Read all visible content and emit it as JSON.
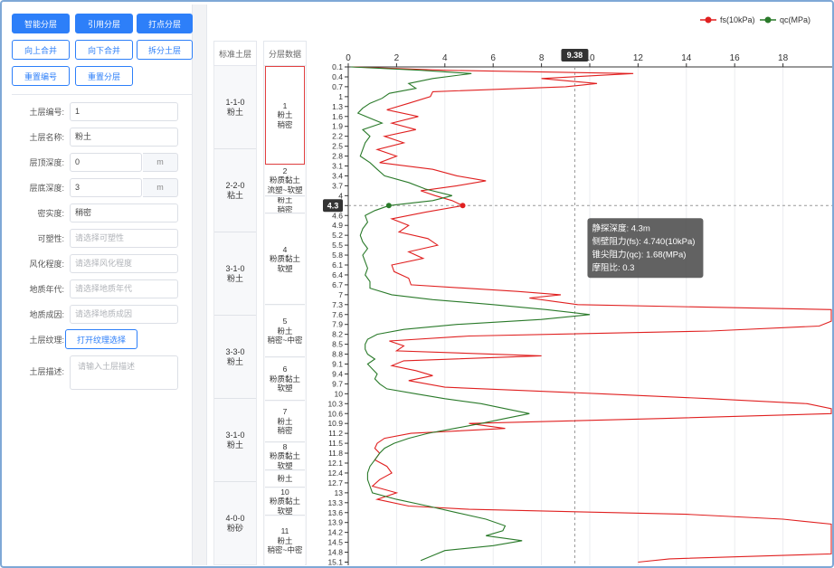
{
  "toolbar": {
    "row1": [
      "智能分层",
      "引用分层",
      "打点分层"
    ],
    "row2": [
      "向上合并",
      "向下合并",
      "拆分土层"
    ],
    "row3": [
      "重置编号",
      "重置分层"
    ]
  },
  "form": {
    "soil_no": {
      "label": "土层编号:",
      "value": "1"
    },
    "soil_name": {
      "label": "土层名称:",
      "value": "粉土"
    },
    "top_depth": {
      "label": "层顶深度:",
      "value": "0",
      "unit": "m"
    },
    "bottom_depth": {
      "label": "层底深度:",
      "value": "3",
      "unit": "m"
    },
    "density": {
      "label": "密实度:",
      "value": "稍密"
    },
    "plasticity": {
      "label": "可塑性:",
      "placeholder": "请选择可塑性"
    },
    "weathering": {
      "label": "风化程度:",
      "placeholder": "请选择风化程度"
    },
    "geo_age": {
      "label": "地质年代:",
      "placeholder": "请选择地质年代"
    },
    "geo_origin": {
      "label": "地质成因:",
      "placeholder": "请选择地质成因"
    },
    "texture": {
      "label": "土层纹理:",
      "button": "打开纹理选择"
    },
    "desc": {
      "label": "土层描述:",
      "placeholder": "请输入土层描述"
    }
  },
  "columns": {
    "std_header": "标准土层",
    "layer_header": "分层数据",
    "std_layers": [
      {
        "code": "1-1-0",
        "name": "粉土"
      },
      {
        "code": "2-2-0",
        "name": "粘土"
      },
      {
        "code": "3-1-0",
        "name": "粉土"
      },
      {
        "code": "3-3-0",
        "name": "粉土"
      },
      {
        "code": "3-1-0",
        "name": "粉土"
      },
      {
        "code": "4-0-0",
        "name": "粉砂"
      }
    ],
    "layers": [
      {
        "no": "1",
        "name": "粉土",
        "state": "稍密"
      },
      {
        "no": "2",
        "name": "粉质黏土",
        "state": "流塑~软塑"
      },
      {
        "no": "",
        "name": "粉土",
        "state": "稍密"
      },
      {
        "no": "4",
        "name": "粉质黏土",
        "state": "软塑"
      },
      {
        "no": "5",
        "name": "粉土",
        "state": "稍密~中密"
      },
      {
        "no": "6",
        "name": "粉质黏土",
        "state": "软塑"
      },
      {
        "no": "7",
        "name": "粉土",
        "state": "稍密"
      },
      {
        "no": "8",
        "name": "粉质黏土",
        "state": "软塑"
      },
      {
        "no": "",
        "name": "粉土",
        "state": ""
      },
      {
        "no": "10",
        "name": "粉质黏土",
        "state": "软塑"
      },
      {
        "no": "11",
        "name": "粉土",
        "state": "稍密~中密"
      }
    ]
  },
  "chart_data": {
    "type": "line",
    "legend": [
      "fs(10kPa)",
      "qc(MPa)"
    ],
    "legend_position": "top-right",
    "x_ticks": [
      "0",
      "2",
      "4",
      "6",
      "8",
      "10",
      "12",
      "14",
      "16",
      "18"
    ],
    "xlim": [
      0,
      20
    ],
    "y_ticks": [
      "0.1",
      "0.4",
      "0.7",
      "1",
      "1.3",
      "1.6",
      "1.9",
      "2.2",
      "2.5",
      "2.8",
      "3.1",
      "3.4",
      "3.7",
      "4",
      "4.3",
      "4.6",
      "4.9",
      "5.2",
      "5.5",
      "5.8",
      "6.1",
      "6.4",
      "6.7",
      "7",
      "7.3",
      "7.6",
      "7.9",
      "8.2",
      "8.5",
      "8.8",
      "9.1",
      "9.4",
      "9.7",
      "10",
      "10.3",
      "10.6",
      "10.9",
      "11.2",
      "11.5",
      "11.8",
      "12.1",
      "12.4",
      "12.7",
      "13",
      "13.3",
      "13.6",
      "13.9",
      "14.2",
      "14.5",
      "14.8",
      "15.1"
    ],
    "ylim": [
      0.1,
      15.1
    ],
    "crosshair": {
      "x_label": "9.38",
      "y_label": "4.3",
      "x_value": 9.38,
      "y_value": 4.3
    },
    "series": [
      {
        "name": "fs(10kPa)",
        "color": "#e02020",
        "depth": [
          0.1,
          0.2,
          0.3,
          0.45,
          0.6,
          0.7,
          0.85,
          1.0,
          1.2,
          1.4,
          1.6,
          1.8,
          2.0,
          2.2,
          2.4,
          2.6,
          2.8,
          3.0,
          3.2,
          3.4,
          3.55,
          3.7,
          3.85,
          4.0,
          4.15,
          4.3,
          4.5,
          4.7,
          4.9,
          5.1,
          5.3,
          5.5,
          5.7,
          5.9,
          6.1,
          6.3,
          6.5,
          6.7,
          6.9,
          7.0,
          7.1,
          7.2,
          7.3,
          7.45,
          7.6,
          7.8,
          7.95,
          8.1,
          8.25,
          8.4,
          8.55,
          8.7,
          8.85,
          9.0,
          9.15,
          9.3,
          9.45,
          9.6,
          9.8,
          10.0,
          10.15,
          10.3,
          10.45,
          10.6,
          10.75,
          10.9,
          11.05,
          11.2,
          11.35,
          11.5,
          11.65,
          11.8,
          12.0,
          12.2,
          12.4,
          12.6,
          12.8,
          13.0,
          13.2,
          13.4,
          13.5,
          13.65,
          13.8,
          13.95,
          14.1,
          14.3,
          14.5,
          14.7,
          14.85,
          15.0,
          15.1
        ],
        "value": [
          0.2,
          4,
          11.8,
          8,
          10.3,
          9,
          3.5,
          3.4,
          2.5,
          1.6,
          2.9,
          1.8,
          2.8,
          1.5,
          2.3,
          1.2,
          2,
          1.3,
          3.5,
          4.5,
          5.7,
          4.5,
          3,
          3.6,
          4.3,
          4.74,
          3.2,
          1.8,
          2.5,
          2.1,
          3.3,
          3.7,
          2.5,
          3.1,
          1.8,
          1.9,
          2.5,
          2.6,
          7,
          8.8,
          7.5,
          8.5,
          9.5,
          20,
          20,
          20,
          19.5,
          15,
          5,
          1.7,
          2.3,
          2,
          8,
          2.3,
          1.8,
          2.8,
          3.5,
          2.5,
          4,
          10.5,
          15,
          19,
          20,
          20,
          13,
          5,
          6.5,
          2.6,
          1.5,
          1.2,
          1.1,
          1.3,
          1.1,
          1.6,
          1.8,
          1.3,
          1.0,
          2.0,
          1.2,
          2.5,
          5,
          14,
          18,
          20,
          20,
          20,
          20,
          20,
          20,
          13.3,
          12
        ]
      },
      {
        "name": "qc(MPa)",
        "color": "#2a7a2a",
        "depth": [
          0.1,
          0.2,
          0.3,
          0.45,
          0.6,
          0.75,
          0.9,
          1.05,
          1.2,
          1.35,
          1.5,
          1.65,
          1.8,
          2.0,
          2.2,
          2.4,
          2.6,
          2.8,
          3.0,
          3.2,
          3.4,
          3.6,
          3.8,
          4.0,
          4.15,
          4.3,
          4.45,
          4.6,
          4.8,
          5.0,
          5.2,
          5.4,
          5.6,
          5.8,
          6.0,
          6.2,
          6.4,
          6.6,
          6.8,
          7.0,
          7.15,
          7.3,
          7.45,
          7.6,
          7.75,
          7.9,
          8.05,
          8.2,
          8.35,
          8.5,
          8.65,
          8.8,
          8.95,
          9.1,
          9.25,
          9.4,
          9.55,
          9.7,
          9.85,
          10.0,
          10.15,
          10.3,
          10.45,
          10.6,
          10.75,
          10.9,
          11.05,
          11.2,
          11.35,
          11.5,
          11.65,
          11.8,
          12.0,
          12.2,
          12.4,
          12.6,
          12.8,
          13.0,
          13.2,
          13.4,
          13.6,
          13.8,
          14.0,
          14.15,
          14.3,
          14.45,
          14.6,
          14.75,
          14.9,
          15.05
        ],
        "value": [
          0.1,
          3,
          5.1,
          3.5,
          2.5,
          2.8,
          1.7,
          1.4,
          0.9,
          0.6,
          0.4,
          0.9,
          1.4,
          0.6,
          0.9,
          0.7,
          0.6,
          0.5,
          0.9,
          1.2,
          1.5,
          2.5,
          3.2,
          4.3,
          3.5,
          1.68,
          1.1,
          0.7,
          0.8,
          0.6,
          0.5,
          0.6,
          0.8,
          0.6,
          0.7,
          0.8,
          0.7,
          0.9,
          0.9,
          1.8,
          3.5,
          6,
          8.2,
          10,
          8,
          4.5,
          2.3,
          1.2,
          0.8,
          0.7,
          0.7,
          0.8,
          1.1,
          0.8,
          1.0,
          1.2,
          1.1,
          1.3,
          1.6,
          2.8,
          4,
          5.5,
          6.5,
          7.5,
          6.5,
          5.5,
          4.4,
          3.3,
          2.5,
          1.9,
          1.5,
          1.3,
          1.1,
          0.9,
          0.8,
          0.8,
          0.9,
          1.0,
          2.0,
          3.3,
          4.5,
          5.7,
          6.5,
          6.4,
          5.7,
          7.2,
          6.0,
          4.0,
          3.5,
          3.0
        ]
      }
    ]
  },
  "tooltip": {
    "lines": [
      "静探深度: 4.3m",
      "侧壁阻力(fs): 4.740(10kPa)",
      "锥尖阻力(qc): 1.68(MPa)",
      "摩阻比: 0.3"
    ]
  }
}
